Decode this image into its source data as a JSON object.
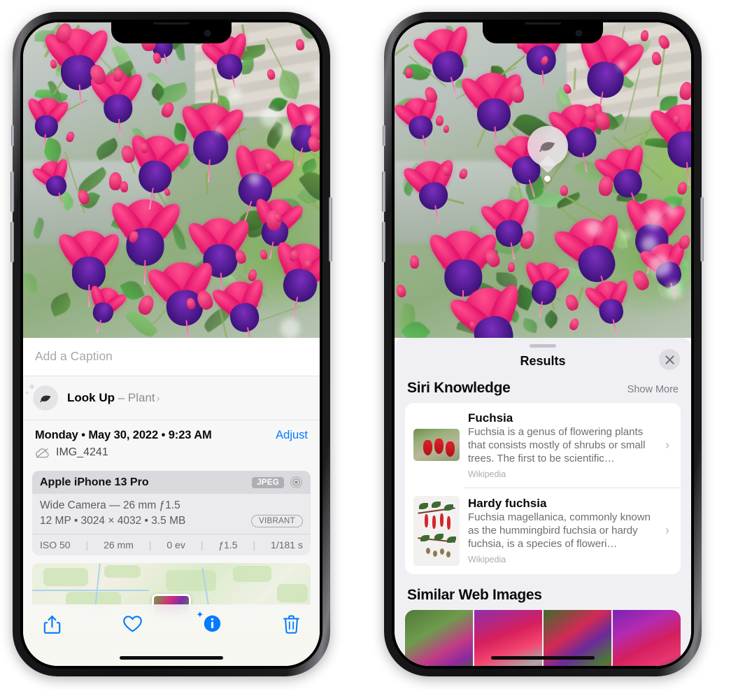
{
  "left_phone": {
    "caption": {
      "placeholder": "Add a Caption",
      "value": ""
    },
    "lookup": {
      "title": "Look Up",
      "separator": " – ",
      "subject": "Plant",
      "chevron": "›",
      "icon": "leaf-icon"
    },
    "metadata": {
      "date": "Monday • May 30, 2022 • 9:23 AM",
      "adjust_label": "Adjust",
      "filename": "IMG_4241",
      "cloud_icon": "icloud-slash-icon"
    },
    "camera_card": {
      "device": "Apple iPhone 13 Pro",
      "format_badge": "JPEG",
      "aperture_icon": "aperture-icon",
      "lens_line": "Wide Camera — 26 mm ƒ1.5",
      "size_line": "12 MP • 3024 × 4032 • 3.5 MB",
      "style_badge": "VIBRANT",
      "exif": [
        "ISO 50",
        "26 mm",
        "0 ev",
        "ƒ1.5",
        "1/181 s"
      ]
    },
    "toolbar": [
      {
        "name": "share-button",
        "icon": "share-icon"
      },
      {
        "name": "favorite-button",
        "icon": "heart-icon"
      },
      {
        "name": "info-button",
        "icon": "info-sparkle-icon"
      },
      {
        "name": "delete-button",
        "icon": "trash-icon"
      }
    ]
  },
  "right_phone": {
    "pin": {
      "icon": "leaf-icon"
    },
    "sheet": {
      "title": "Results",
      "close_icon": "close-icon"
    },
    "siri_knowledge": {
      "heading": "Siri Knowledge",
      "action": "Show More",
      "items": [
        {
          "title": "Fuchsia",
          "description": "Fuchsia is a genus of flowering plants that consists mostly of shrubs or small trees. The first to be scientific…",
          "source": "Wikipedia",
          "thumb": "fuchsia-red-flowers"
        },
        {
          "title": "Hardy fuchsia",
          "description": "Fuchsia magellanica, commonly known as the hummingbird fuchsia or hardy fuchsia, is a species of floweri…",
          "source": "Wikipedia",
          "thumb": "botanical-specimen"
        }
      ]
    },
    "similar_web_images": {
      "heading": "Similar Web Images",
      "items": [
        "pink-white-fuchsia",
        "red-fuchsia-closeup",
        "fuchsia-bush",
        "purple-pink-fuchsia"
      ]
    }
  },
  "colors": {
    "accent_blue": "#047aff",
    "sheet_bg": "#f0f0f4",
    "card_bg": "#ffffff",
    "secondary_text": "#6e6e73"
  }
}
